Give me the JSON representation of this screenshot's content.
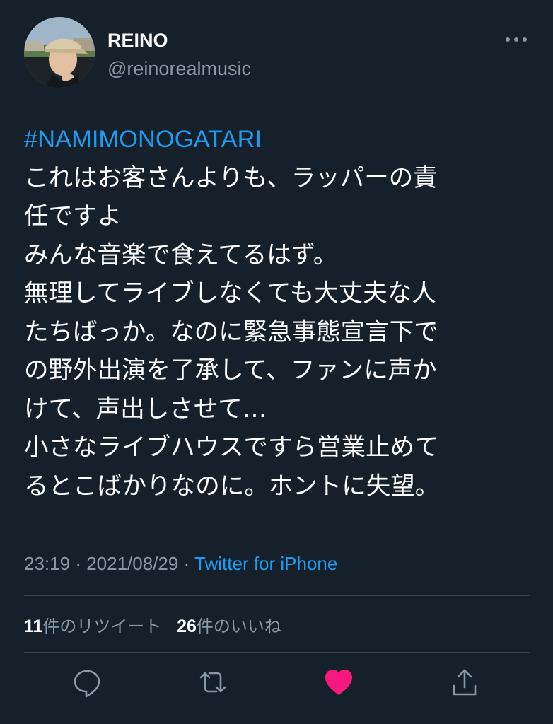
{
  "user": {
    "name": "REINO",
    "handle": "@reinorealmusic"
  },
  "tweet": {
    "hashtag": "#NAMIMONOGATARI",
    "lines": [
      "これはお客さんよりも、ラッパーの責",
      "任ですよ",
      "みんな音楽で食えてるはず。",
      "無理してライブしなくても大丈夫な人",
      "たちばっか。なのに緊急事態宣言下で",
      "の野外出演を了承して、ファンに声か",
      "けて、声出しさせて…",
      "小さなライブハウスですら営業止めて",
      "るとこばかりなのに。ホントに失望。"
    ],
    "time": "23:19",
    "separator": "·",
    "date": "2021/08/29",
    "source": "Twitter for iPhone"
  },
  "stats": {
    "retweets_count": "11",
    "retweets_label": "件のリツイート",
    "likes_count": "26",
    "likes_label": "件のいいね"
  },
  "icons": {
    "more": "more-dots-icon",
    "reply": "reply-icon",
    "retweet": "retweet-icon",
    "like": "heart-icon",
    "share": "share-icon"
  },
  "colors": {
    "background": "#15202b",
    "accent": "#1d9bf0",
    "secondary_text": "#8899a6",
    "like": "#f91880",
    "divider": "#38444d"
  }
}
